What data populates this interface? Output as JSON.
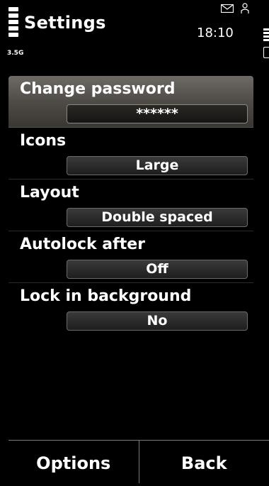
{
  "status_bar": {
    "title": "Settings",
    "network": "3.5G",
    "time": "18:10",
    "icons": [
      "signal-icon",
      "mail-icon",
      "person-icon",
      "battery-icon"
    ]
  },
  "settings": [
    {
      "label": "Change password",
      "value": "******",
      "selected": true
    },
    {
      "label": "Icons",
      "value": "Large",
      "selected": false
    },
    {
      "label": "Layout",
      "value": "Double spaced",
      "selected": false
    },
    {
      "label": "Autolock after",
      "value": "Off",
      "selected": false
    },
    {
      "label": "Lock in background",
      "value": "No",
      "selected": false
    }
  ],
  "softkeys": {
    "left": "Options",
    "right": "Back"
  },
  "colors": {
    "background": "#000000",
    "text": "#ffffff",
    "highlight": "#5a5651"
  }
}
